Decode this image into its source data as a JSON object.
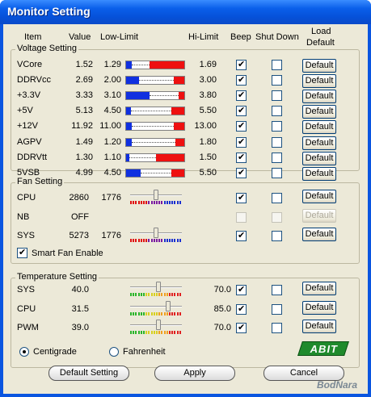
{
  "window": {
    "title": "Monitor Setting"
  },
  "headers": {
    "item": "Item",
    "value": "Value",
    "low": "Low-Limit",
    "hi": "Hi-Limit",
    "beep": "Beep",
    "shutdown": "Shut Down",
    "load1": "Load",
    "load2": "Default"
  },
  "voltage": {
    "title": "Voltage Setting",
    "rows": [
      {
        "name": "VCore",
        "value": "1.52",
        "low": "1.29",
        "hi": "1.69",
        "beep": true,
        "shutdown": false,
        "button": "Default",
        "bar": {
          "blue": 0.1,
          "red_from": 0.4
        }
      },
      {
        "name": "DDRVcc",
        "value": "2.69",
        "low": "2.00",
        "hi": "3.00",
        "beep": true,
        "shutdown": false,
        "button": "Default",
        "bar": {
          "blue": 0.22,
          "red_from": 0.82
        }
      },
      {
        "name": "+3.3V",
        "value": "3.33",
        "low": "3.10",
        "hi": "3.80",
        "beep": true,
        "shutdown": false,
        "button": "Default",
        "bar": {
          "blue": 0.4,
          "red_from": 0.9
        }
      },
      {
        "name": "+5V",
        "value": "5.13",
        "low": "4.50",
        "hi": "5.50",
        "beep": true,
        "shutdown": false,
        "button": "Default",
        "bar": {
          "blue": 0.08,
          "red_from": 0.78
        }
      },
      {
        "name": "+12V",
        "value": "11.92",
        "low": "11.00",
        "hi": "13.00",
        "beep": true,
        "shutdown": false,
        "button": "Default",
        "bar": {
          "blue": 0.1,
          "red_from": 0.82
        }
      },
      {
        "name": "AGPV",
        "value": "1.49",
        "low": "1.20",
        "hi": "1.80",
        "beep": true,
        "shutdown": false,
        "button": "Default",
        "bar": {
          "blue": 0.1,
          "red_from": 0.85
        }
      },
      {
        "name": "DDRVtt",
        "value": "1.30",
        "low": "1.10",
        "hi": "1.50",
        "beep": true,
        "shutdown": false,
        "button": "Default",
        "bar": {
          "blue": 0.06,
          "red_from": 0.52
        }
      },
      {
        "name": "5VSB",
        "value": "4.99",
        "low": "4.50",
        "hi": "5.50",
        "beep": true,
        "shutdown": false,
        "button": "Default",
        "bar": {
          "blue": 0.25,
          "red_from": 0.78
        }
      }
    ]
  },
  "fan": {
    "title": "Fan Setting",
    "rows": [
      {
        "name": "CPU",
        "value": "2860",
        "low": "1776",
        "beep": true,
        "shutdown": false,
        "enabled": true,
        "button": "Default",
        "slider": 0.5
      },
      {
        "name": "NB",
        "value": "OFF",
        "low": "",
        "beep": false,
        "shutdown": false,
        "enabled": false,
        "button": "Default",
        "slider": null
      },
      {
        "name": "SYS",
        "value": "5273",
        "low": "1776",
        "beep": true,
        "shutdown": false,
        "enabled": true,
        "button": "Default",
        "slider": 0.5
      }
    ],
    "smart_fan": {
      "label": "Smart Fan Enable",
      "checked": true
    }
  },
  "temp": {
    "title": "Temperature Setting",
    "rows": [
      {
        "name": "SYS",
        "value": "40.0",
        "hi": "70.0",
        "beep": true,
        "shutdown": false,
        "button": "Default",
        "slider": 0.55
      },
      {
        "name": "CPU",
        "value": "31.5",
        "hi": "85.0",
        "beep": true,
        "shutdown": false,
        "button": "Default",
        "slider": 0.75
      },
      {
        "name": "PWM",
        "value": "39.0",
        "hi": "70.0",
        "beep": true,
        "shutdown": false,
        "button": "Default",
        "slider": 0.55
      }
    ],
    "units": {
      "centigrade": "Centigrade",
      "fahrenheit": "Fahrenheit",
      "selected": "centigrade"
    }
  },
  "logo": "ABIT",
  "buttons": {
    "default_setting": "Default Setting",
    "apply": "Apply",
    "cancel": "Cancel"
  },
  "watermark": "BodNara",
  "colors": {
    "low_bar": "#1030e0",
    "high_bar": "#ee1010",
    "beep_check": "#21a121"
  }
}
